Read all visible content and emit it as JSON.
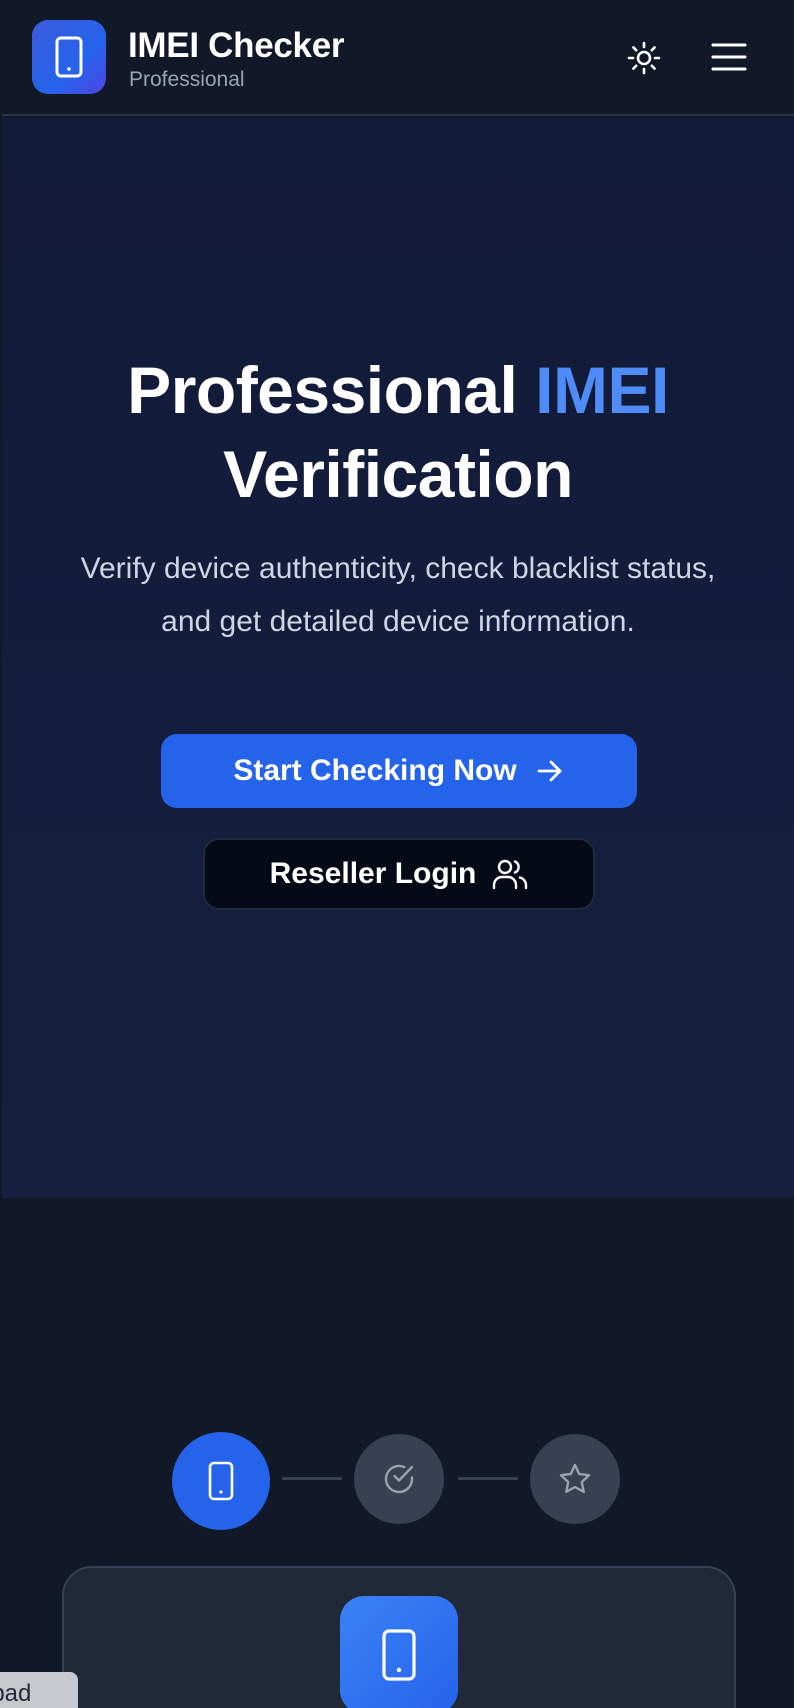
{
  "header": {
    "brand_title": "IMEI Checker",
    "brand_subtitle": "Professional",
    "icons": {
      "logo": "smartphone-icon",
      "theme": "sun-icon",
      "menu": "hamburger-menu-icon"
    }
  },
  "hero": {
    "title_part1": "Professional ",
    "title_accent": "IMEI",
    "title_part2": "Verification",
    "description": "Verify device authenticity, check blacklist status, and get detailed device information.",
    "primary_button": "Start Checking Now",
    "secondary_button": "Reseller Login"
  },
  "steps": [
    {
      "icon": "smartphone-icon",
      "state": "active"
    },
    {
      "icon": "check-circle-icon",
      "state": "inactive"
    },
    {
      "icon": "star-icon",
      "state": "inactive"
    }
  ],
  "overlay_tag": "ipad",
  "colors": {
    "background": "#111827",
    "hero_background": "#141d3d",
    "accent": "#4f8cf7",
    "primary_button": "#2563eb",
    "step_inactive": "#374151",
    "card_background": "#1f2937"
  }
}
